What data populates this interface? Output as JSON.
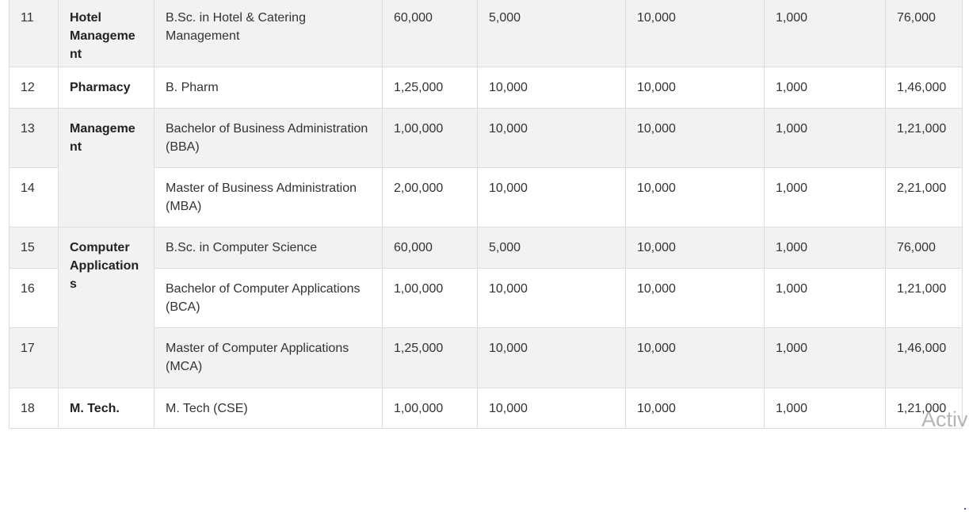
{
  "rows": [
    {
      "sno": "11",
      "dept": "Hotel Management",
      "course": "B.Sc. in Hotel & Catering Management",
      "fee1": "60,000",
      "fee2": "5,000",
      "fee3": "10,000",
      "fee4": "1,000",
      "total": "76,000"
    },
    {
      "sno": "12",
      "dept": "Pharmacy",
      "course": "B. Pharm",
      "fee1": "1,25,000",
      "fee2": "10,000",
      "fee3": "10,000",
      "fee4": "1,000",
      "total": "1,46,000"
    },
    {
      "sno": "13",
      "dept": "Management",
      "course": "Bachelor of Business Administration (BBA)",
      "fee1": "1,00,000",
      "fee2": "10,000",
      "fee3": "10,000",
      "fee4": "1,000",
      "total": "1,21,000"
    },
    {
      "sno": "14",
      "dept": "",
      "course": "Master of Business Administration (MBA)",
      "fee1": "2,00,000",
      "fee2": "10,000",
      "fee3": "10,000",
      "fee4": "1,000",
      "total": "2,21,000"
    },
    {
      "sno": "15",
      "dept": "Computer Applications",
      "course": "B.Sc. in Computer Science",
      "fee1": "60,000",
      "fee2": "5,000",
      "fee3": "10,000",
      "fee4": "1,000",
      "total": "76,000"
    },
    {
      "sno": "16",
      "dept": "",
      "course": "Bachelor of Computer Applications (BCA)",
      "fee1": "1,00,000",
      "fee2": "10,000",
      "fee3": "10,000",
      "fee4": "1,000",
      "total": "1,21,000"
    },
    {
      "sno": "17",
      "dept": "",
      "course": "Master of Computer Applications (MCA)",
      "fee1": "1,25,000",
      "fee2": "10,000",
      "fee3": "10,000",
      "fee4": "1,000",
      "total": "1,46,000"
    },
    {
      "sno": "18",
      "dept": "M. Tech.",
      "course": "M. Tech (CSE)",
      "fee1": "1,00,000",
      "fee2": "10,000",
      "fee3": "10,000",
      "fee4": "1,000",
      "total": "1,21,000"
    }
  ],
  "watermark": "Activ"
}
